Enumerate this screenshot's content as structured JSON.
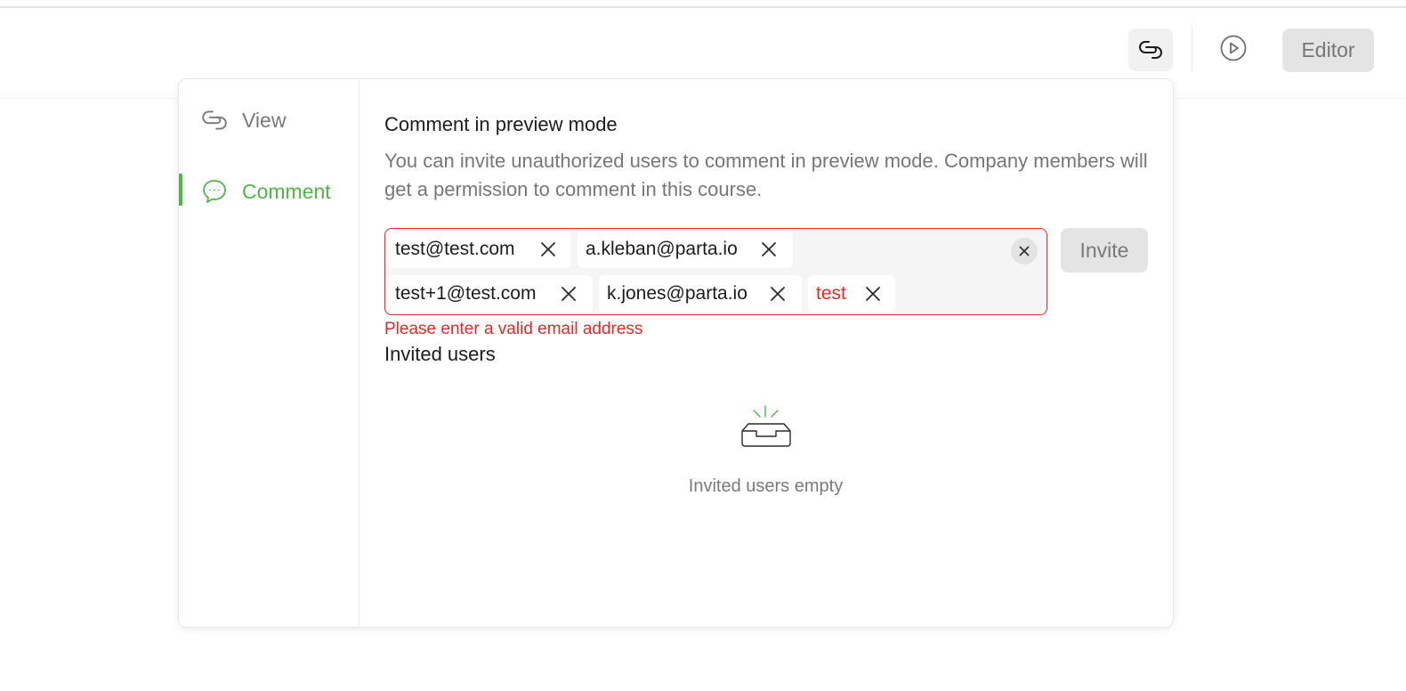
{
  "header": {
    "share_icon": "link-icon",
    "play_icon": "play-circle-icon",
    "editor_label": "Editor"
  },
  "sidebar": {
    "items": [
      {
        "label": "View",
        "icon": "link-icon",
        "active": false
      },
      {
        "label": "Comment",
        "icon": "comment-icon",
        "active": true
      }
    ]
  },
  "panel": {
    "title": "Comment in preview mode",
    "description": "You can invite unauthorized users to comment in preview mode. Company members will get a permission to comment in this course.",
    "tags": [
      {
        "email": "test@test.com",
        "valid": true
      },
      {
        "email": "a.kleban@parta.io",
        "valid": true
      },
      {
        "email": "test+1@test.com",
        "valid": true
      },
      {
        "email": "k.jones@parta.io",
        "valid": true
      },
      {
        "email": "test",
        "valid": false
      }
    ],
    "invite_label": "Invite",
    "error_text": "Please enter a valid email address",
    "invited_heading": "Invited users",
    "empty_text": "Invited users empty"
  },
  "colors": {
    "accent": "#4cb944",
    "error": "#e72626",
    "muted": "#777777"
  }
}
